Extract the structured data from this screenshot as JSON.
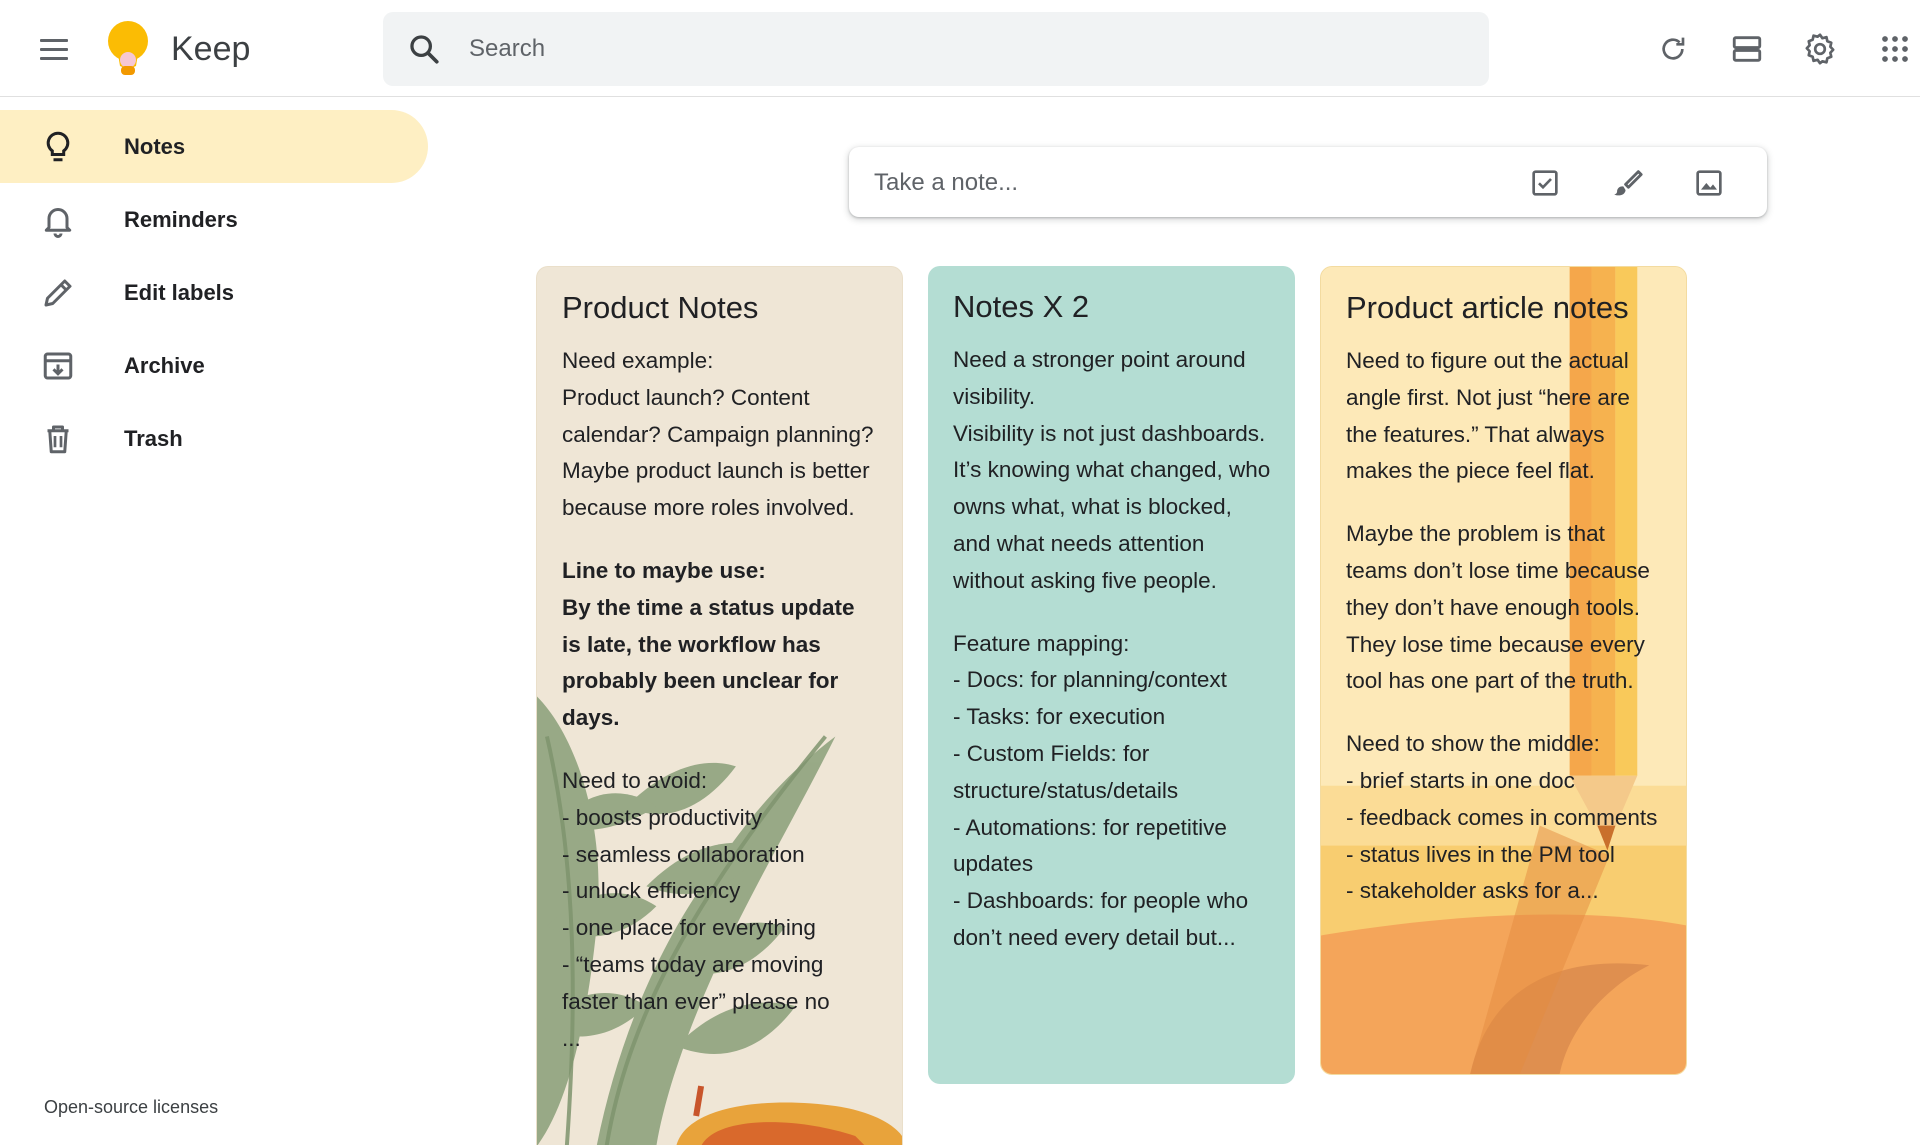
{
  "app": {
    "title": "Keep"
  },
  "header": {
    "menu_icon": "hamburger-menu-icon",
    "logo_icon": "keep-lightbulb-logo",
    "search": {
      "placeholder": "Search",
      "icon": "search-icon"
    },
    "actions": [
      {
        "name": "refresh",
        "icon": "refresh-icon"
      },
      {
        "name": "list-view",
        "icon": "list-view-icon"
      },
      {
        "name": "settings",
        "icon": "gear-icon"
      },
      {
        "name": "apps",
        "icon": "apps-grid-icon"
      }
    ]
  },
  "sidebar": {
    "items": [
      {
        "label": "Notes",
        "icon": "lightbulb-icon",
        "active": true
      },
      {
        "label": "Reminders",
        "icon": "bell-icon",
        "active": false
      },
      {
        "label": "Edit labels",
        "icon": "pencil-icon",
        "active": false
      },
      {
        "label": "Archive",
        "icon": "archive-icon",
        "active": false
      },
      {
        "label": "Trash",
        "icon": "trash-icon",
        "active": false
      }
    ],
    "footer_link": "Open-source licenses"
  },
  "composer": {
    "placeholder": "Take a note...",
    "actions": [
      {
        "name": "new-list",
        "icon": "checkbox-icon"
      },
      {
        "name": "new-drawing",
        "icon": "brush-icon"
      },
      {
        "name": "new-image",
        "icon": "image-icon"
      }
    ]
  },
  "notes": [
    {
      "title": "Product Notes",
      "color": "#efe6d6",
      "background_theme": "plant-leaves",
      "paragraphs": [
        [
          "Need example:",
          "Product launch? Content calendar? Campaign planning? Maybe product launch is better because more roles involved."
        ],
        [
          "Line to maybe use:",
          "By the time a status update is late, the workflow has probably been unclear for days."
        ],
        [
          "Need to avoid:",
          "- boosts productivity",
          "- seamless collaboration",
          "- unlock efficiency",
          "- one place for everything",
          "- “teams today are moving faster than ever” please no",
          "..."
        ]
      ]
    },
    {
      "title": "Notes X 2",
      "color": "#b4ddd3",
      "paragraphs": [
        [
          "Need a stronger point around visibility.",
          "Visibility is not just dashboards. It’s knowing what changed, who owns what, what is blocked, and what needs attention without asking five people."
        ],
        [
          "Feature mapping:",
          "- Docs: for planning/context",
          "- Tasks: for execution",
          "- Custom Fields: for structure/status/details",
          "- Automations: for repetitive updates",
          "- Dashboards: for people who don’t need every detail but..."
        ]
      ]
    },
    {
      "title": "Product article notes",
      "color": "#fde9b8",
      "background_theme": "pencil-sunset",
      "paragraphs": [
        [
          "Need to figure out the actual angle first. Not just “here are the features.” That always makes the piece feel flat."
        ],
        [
          "Maybe the problem is that teams don’t lose time because they don’t have enough tools. They lose time because every tool has one part of the truth."
        ],
        [
          "Need to show the middle:",
          "- brief starts in one doc",
          "- feedback comes in comments",
          "- status lives in the PM tool",
          "- stakeholder asks for a..."
        ]
      ]
    }
  ]
}
